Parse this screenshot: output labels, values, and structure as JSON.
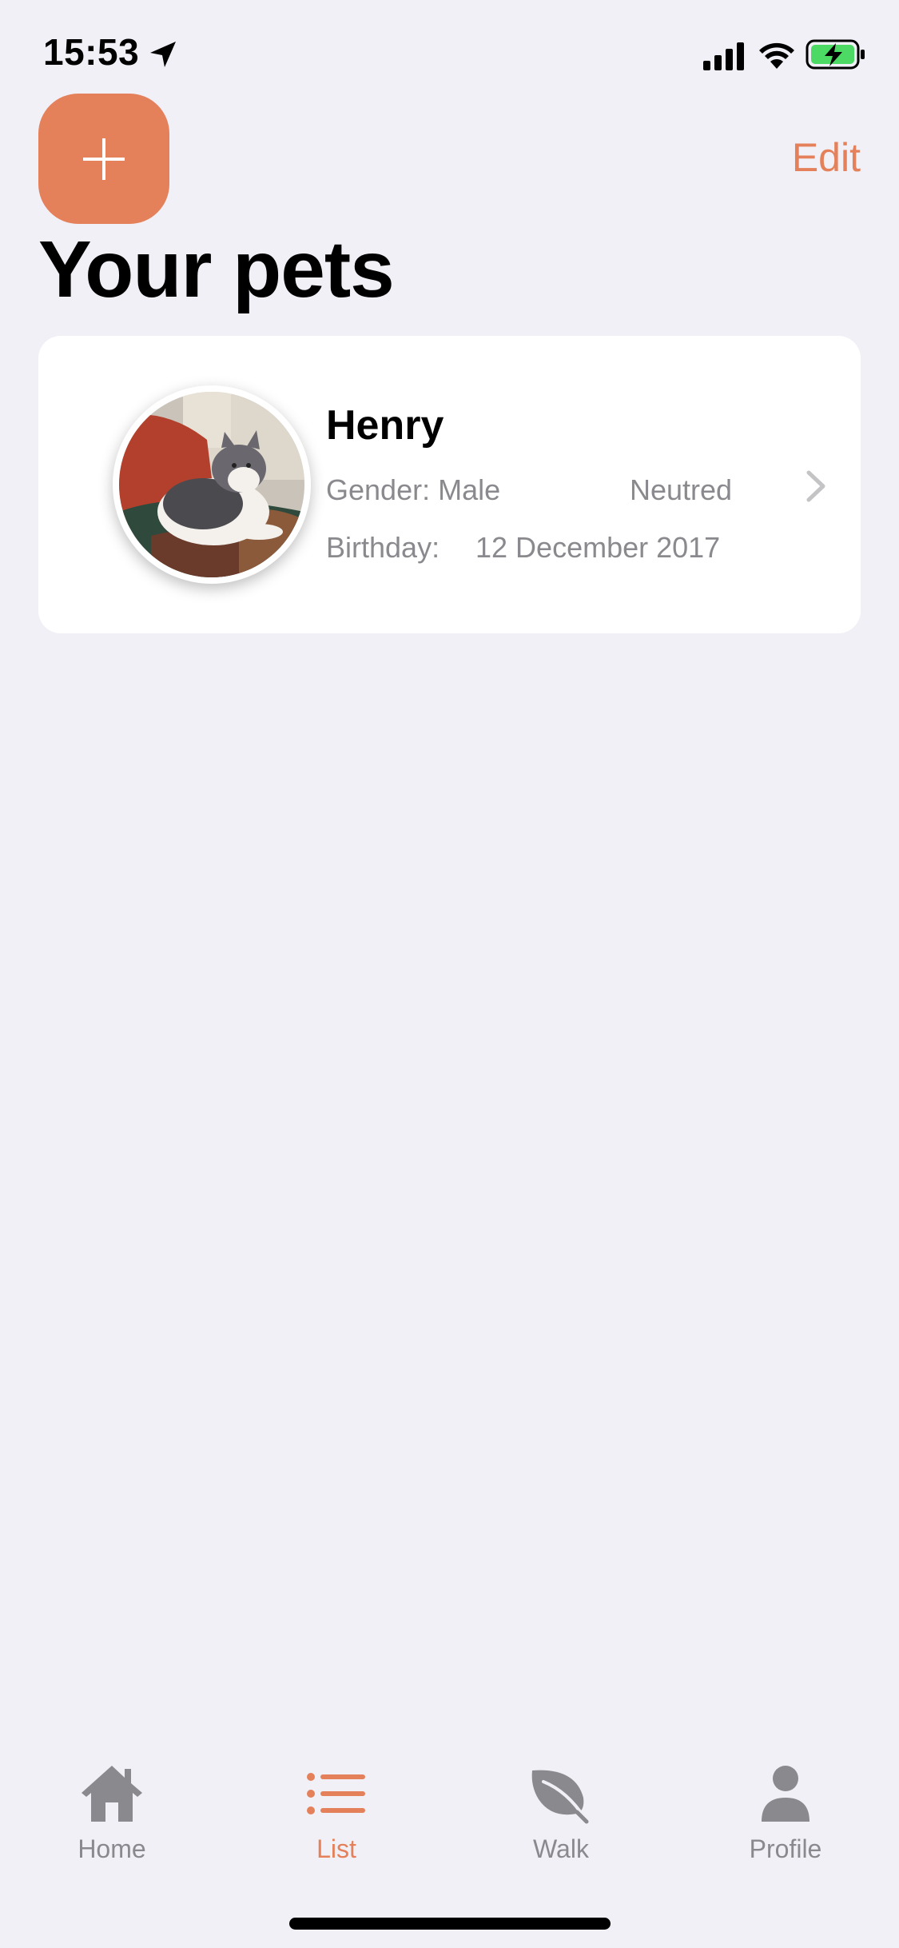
{
  "status_bar": {
    "time": "15:53",
    "icons": [
      "location-arrow-icon",
      "cellular-signal-icon",
      "wifi-icon",
      "battery-charging-icon"
    ]
  },
  "nav": {
    "add_button_icon": "plus-icon",
    "edit_label": "Edit"
  },
  "page": {
    "title": "Your pets"
  },
  "pets": [
    {
      "name": "Henry",
      "gender": "Gender: Male",
      "neutered": "Neutred",
      "birthday_label": "Birthday:",
      "birthday": "12 December 2017",
      "avatar": "cat-photo"
    }
  ],
  "tab_bar": {
    "items": [
      {
        "label": "Home",
        "icon": "house-icon",
        "active": false
      },
      {
        "label": "List",
        "icon": "list-icon",
        "active": true
      },
      {
        "label": "Walk",
        "icon": "leaf-icon",
        "active": false
      },
      {
        "label": "Profile",
        "icon": "person-icon",
        "active": false
      }
    ]
  },
  "colors": {
    "accent": "#e4805a",
    "background": "#f1f0f6",
    "card": "#ffffff",
    "secondary_text": "#8a8a8e",
    "battery_fill": "#4cd964"
  }
}
